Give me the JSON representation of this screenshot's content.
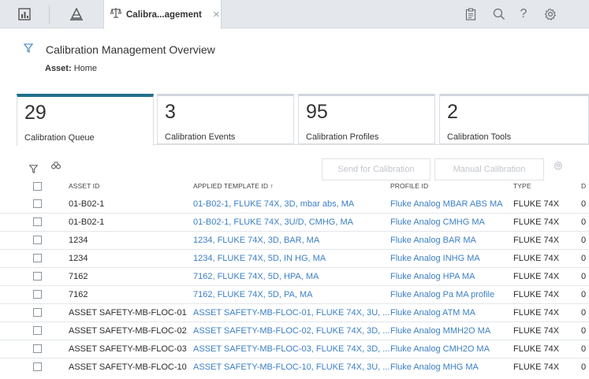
{
  "topbar": {
    "active_tab": "Calibra...agement",
    "close_symbol": "×",
    "icons": [
      "dashboard-icon",
      "asset-hierarchy-icon",
      "calibration-icon",
      "clipboard-icon",
      "search-icon",
      "help-icon",
      "settings-icon"
    ],
    "help_symbol": "?"
  },
  "header": {
    "title": "Calibration Management Overview",
    "asset_label": "Asset:",
    "asset_value": "Home"
  },
  "cards": [
    {
      "count": "29",
      "label": "Calibration Queue"
    },
    {
      "count": "3",
      "label": "Calibration Events"
    },
    {
      "count": "95",
      "label": "Calibration Profiles"
    },
    {
      "count": "2",
      "label": "Calibration Tools"
    }
  ],
  "toolbar": {
    "send_button": "Send for Calibration",
    "manual_button": "Manual Calibration"
  },
  "table": {
    "columns": [
      "ASSET ID",
      "APPLIED TEMPLATE ID ↑",
      "PROFILE ID",
      "TYPE",
      "D"
    ],
    "rows": [
      {
        "asset": "01-B02-1",
        "template": "01-B02-1, FLUKE 74X, 3D, mbar abs, MA",
        "profile": "Fluke Analog MBAR ABS MA",
        "type": "FLUKE 74X",
        "d": "0"
      },
      {
        "asset": "01-B02-1",
        "template": "01-B02-1, FLUKE 74X, 3U/D, CMHG, MA",
        "profile": "Fluke Analog CMHG MA",
        "type": "FLUKE 74X",
        "d": "0"
      },
      {
        "asset": "1234",
        "template": "1234, FLUKE 74X, 3D, BAR, MA",
        "profile": "Fluke Analog BAR MA",
        "type": "FLUKE 74X",
        "d": "0"
      },
      {
        "asset": "1234",
        "template": "1234, FLUKE 74X, 5D, IN HG, MA",
        "profile": "Fluke Analog INHG MA",
        "type": "FLUKE 74X",
        "d": "0"
      },
      {
        "asset": "7162",
        "template": "7162, FLUKE 74X, 5D, HPA, MA",
        "profile": "Fluke Analog HPA MA",
        "type": "FLUKE 74X",
        "d": "0"
      },
      {
        "asset": "7162",
        "template": "7162, FLUKE 74X, 5D, PA, MA",
        "profile": "Fluke Analog Pa MA profile",
        "type": "FLUKE 74X",
        "d": "0"
      },
      {
        "asset": "ASSET SAFETY-MB-FLOC-01",
        "template": "ASSET SAFETY-MB-FLOC-01, FLUKE 74X, 3U, ...",
        "profile": "Fluke Analog ATM MA",
        "type": "FLUKE 74X",
        "d": "0"
      },
      {
        "asset": "ASSET SAFETY-MB-FLOC-02",
        "template": "ASSET SAFETY-MB-FLOC-02, FLUKE 74X, 3D, ...",
        "profile": "Fluke Analog MMH2O MA",
        "type": "FLUKE 74X",
        "d": "0"
      },
      {
        "asset": "ASSET SAFETY-MB-FLOC-03",
        "template": "ASSET SAFETY-MB-FLOC-03, FLUKE 74X, 3D, ...",
        "profile": "Fluke Analog CMH2O MA",
        "type": "FLUKE 74X",
        "d": "0"
      },
      {
        "asset": "ASSET SAFETY-MB-FLOC-10",
        "template": "ASSET SAFETY-MB-FLOC-10, FLUKE 74X, 3U, ...",
        "profile": "Fluke Analog MHG MA",
        "type": "FLUKE 74X",
        "d": "0"
      }
    ]
  },
  "colors": {
    "accent": "#1f6f8b",
    "link": "#3b7fc4",
    "topbar": "#e4e7eb"
  }
}
